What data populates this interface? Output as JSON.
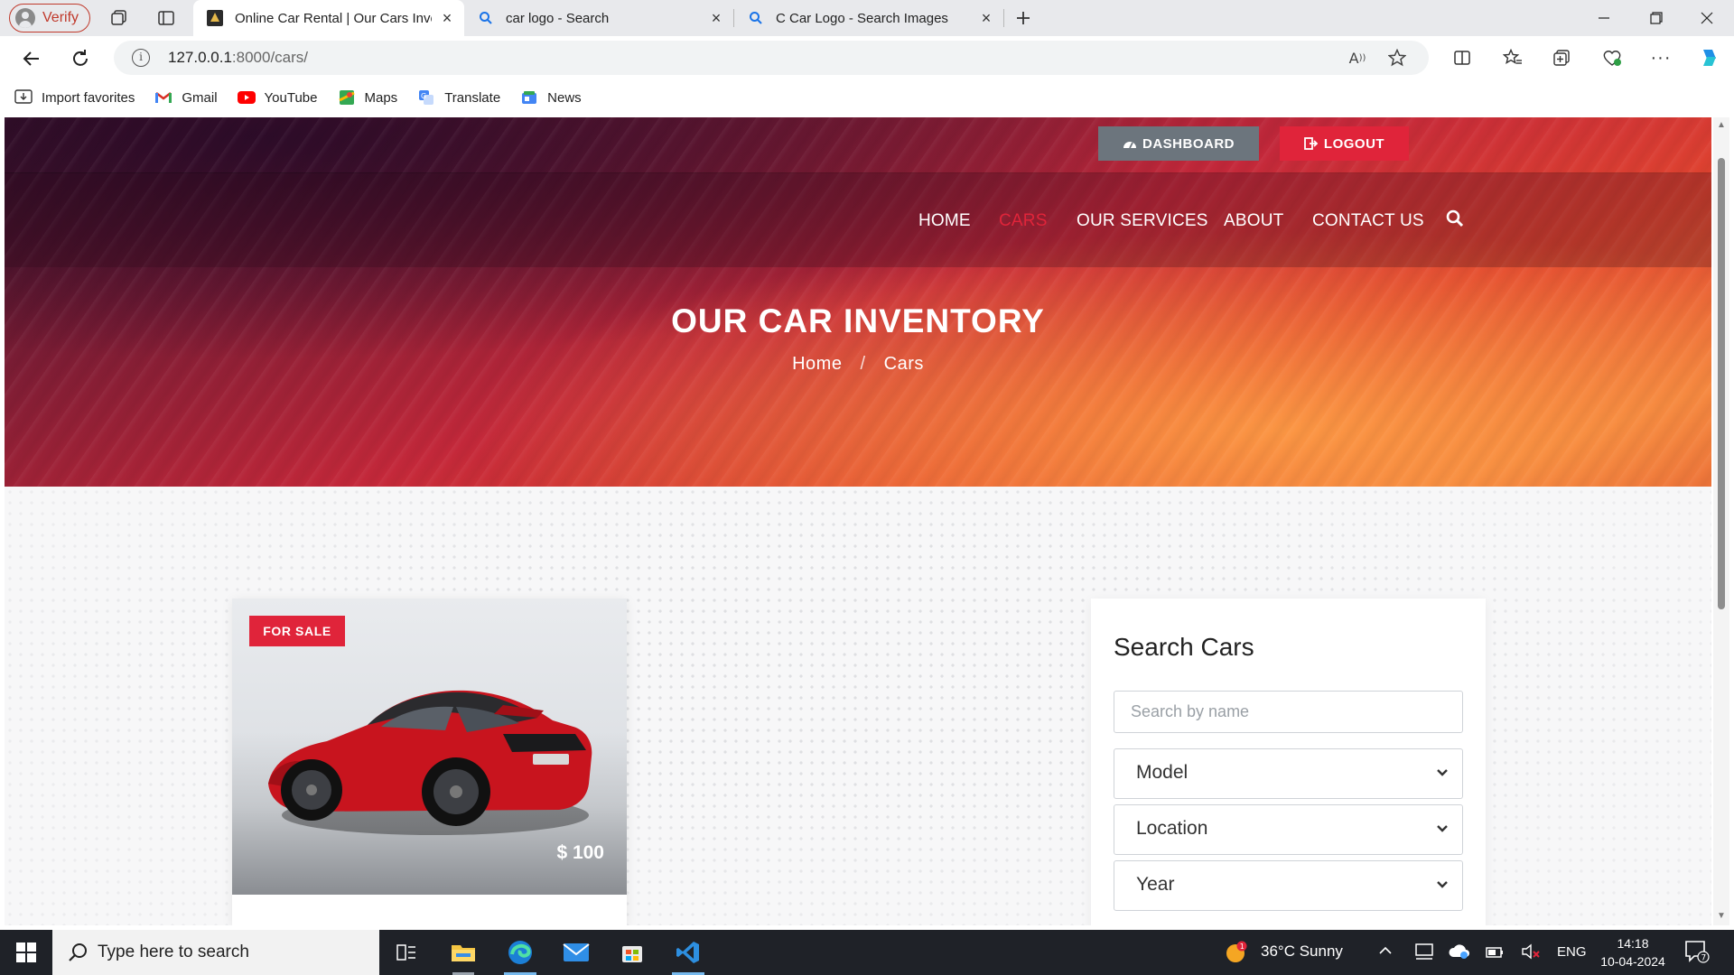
{
  "browser": {
    "profile_label": "Verify",
    "tabs": [
      {
        "title": "Online Car Rental | Our Cars Inve",
        "active": true
      },
      {
        "title": "car logo - Search",
        "active": false
      },
      {
        "title": "C Car Logo - Search Images",
        "active": false
      }
    ],
    "url_host": "127.0.0.1",
    "url_rest": ":8000/cars/",
    "favorites": [
      {
        "label": "Import favorites",
        "icon": "import-icon"
      },
      {
        "label": "Gmail",
        "icon": "gmail-icon"
      },
      {
        "label": "YouTube",
        "icon": "youtube-icon"
      },
      {
        "label": "Maps",
        "icon": "maps-icon"
      },
      {
        "label": "Translate",
        "icon": "translate-icon"
      },
      {
        "label": "News",
        "icon": "news-icon"
      }
    ]
  },
  "site": {
    "dashboard_label": "DASHBOARD",
    "logout_label": "LOGOUT",
    "nav": [
      {
        "label": "HOME",
        "active": false
      },
      {
        "label": "CARS",
        "active": true
      },
      {
        "label": "OUR SERVICES",
        "active": false
      },
      {
        "label": "ABOUT",
        "active": false
      },
      {
        "label": "CONTACT US",
        "active": false
      }
    ],
    "hero_title": "OUR CAR INVENTORY",
    "breadcrumb": {
      "home": "Home",
      "sep": "/",
      "current": "Cars"
    },
    "accent_color": "#e0243a"
  },
  "car_card": {
    "badge": "FOR SALE",
    "price": "$ 100"
  },
  "search_panel": {
    "title": "Search Cars",
    "name_placeholder": "Search by name",
    "selects": [
      "Model",
      "Location",
      "Year"
    ]
  },
  "taskbar": {
    "search_placeholder": "Type here to search",
    "weather_badge": "1",
    "weather": "36°C  Sunny",
    "lang": "ENG",
    "time": "14:18",
    "date": "10-04-2024"
  }
}
